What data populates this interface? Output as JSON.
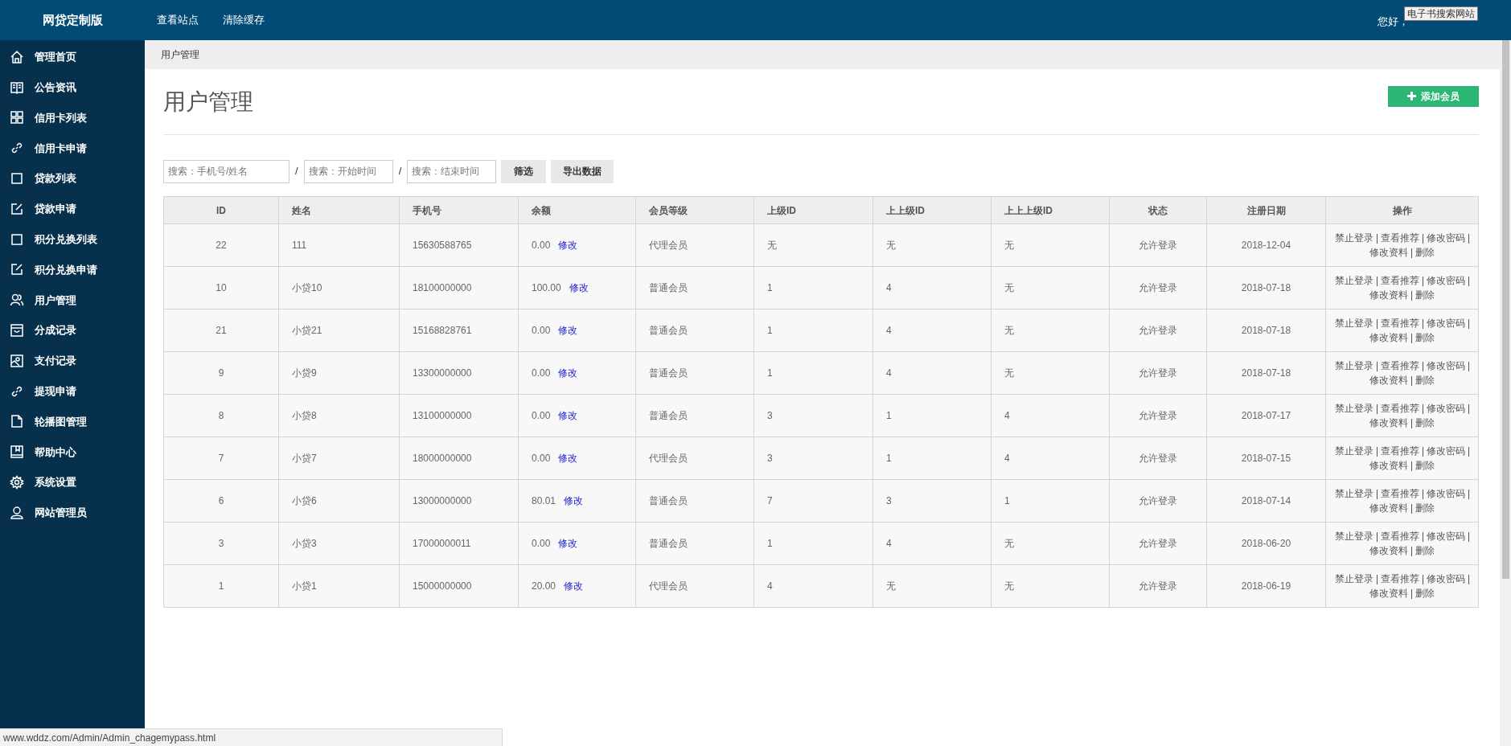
{
  "header": {
    "brand": "网贷定制版",
    "nav": [
      "查看站点",
      "清除缓存"
    ],
    "greeting": "您好，",
    "tooltip": "电子书搜索网站"
  },
  "sidebar": {
    "items": [
      {
        "label": "管理首页",
        "selected": false
      },
      {
        "label": "公告资讯",
        "selected": false
      },
      {
        "label": "信用卡列表",
        "selected": false
      },
      {
        "label": "信用卡申请",
        "selected": false
      },
      {
        "label": "贷款列表",
        "selected": false
      },
      {
        "label": "贷款申请",
        "selected": false
      },
      {
        "label": "积分兑换列表",
        "selected": false
      },
      {
        "label": "积分兑换申请",
        "selected": false
      },
      {
        "label": "用户管理",
        "selected": false
      },
      {
        "label": "分成记录",
        "selected": false
      },
      {
        "label": "支付记录",
        "selected": false
      },
      {
        "label": "提现申请",
        "selected": false
      },
      {
        "label": "轮播图管理",
        "selected": false
      },
      {
        "label": "帮助中心",
        "selected": false
      },
      {
        "label": "系统设置",
        "selected": false
      },
      {
        "label": "网站管理员",
        "selected": false
      }
    ]
  },
  "breadcrumb": "用户管理",
  "page_title": "用户管理",
  "add_button": "添加会员",
  "filters": {
    "fields": [
      {
        "placeholder": "搜索：手机号/姓名"
      },
      {
        "placeholder": "搜索：开始时间"
      },
      {
        "placeholder": "搜索：结束时间"
      }
    ],
    "separators": [
      "/",
      "/"
    ],
    "buttons": [
      "筛选",
      "导出数据"
    ]
  },
  "table": {
    "columns": [
      "ID",
      "姓名",
      "手机号",
      "余额",
      "会员等级",
      "上级ID",
      "上上级ID",
      "上上上级ID",
      "状态",
      "注册日期",
      "操作"
    ],
    "rows": [
      {
        "id": "22",
        "name": "111",
        "phone": "15630588765",
        "balance": "0.00",
        "edit": "修改",
        "level": "代理会员",
        "parent": "无",
        "grandparent": "无",
        "great_grandparent": "无",
        "status": "允许登录",
        "date": "2018-12-04",
        "actions": [
          "禁止登录",
          "查看推荐",
          "修改密码",
          "修改资料",
          "删除"
        ]
      },
      {
        "id": "10",
        "name": "小贷10",
        "phone": "18100000000",
        "balance": "100.00",
        "edit": "修改",
        "level": "普通会员",
        "parent": "1",
        "grandparent": "4",
        "great_grandparent": "无",
        "status": "允许登录",
        "date": "2018-07-18",
        "actions": [
          "禁止登录",
          "查看推荐",
          "修改密码",
          "修改资料",
          "删除"
        ]
      },
      {
        "id": "21",
        "name": "小贷21",
        "phone": "15168828761",
        "balance": "0.00",
        "edit": "修改",
        "level": "普通会员",
        "parent": "1",
        "grandparent": "4",
        "great_grandparent": "无",
        "status": "允许登录",
        "date": "2018-07-18",
        "actions": [
          "禁止登录",
          "查看推荐",
          "修改密码",
          "修改资料",
          "删除"
        ]
      },
      {
        "id": "9",
        "name": "小贷9",
        "phone": "13300000000",
        "balance": "0.00",
        "edit": "修改",
        "level": "普通会员",
        "parent": "1",
        "grandparent": "4",
        "great_grandparent": "无",
        "status": "允许登录",
        "date": "2018-07-18",
        "actions": [
          "禁止登录",
          "查看推荐",
          "修改密码",
          "修改资料",
          "删除"
        ]
      },
      {
        "id": "8",
        "name": "小贷8",
        "phone": "13100000000",
        "balance": "0.00",
        "edit": "修改",
        "level": "普通会员",
        "parent": "3",
        "grandparent": "1",
        "great_grandparent": "4",
        "status": "允许登录",
        "date": "2018-07-17",
        "actions": [
          "禁止登录",
          "查看推荐",
          "修改密码",
          "修改资料",
          "删除"
        ]
      },
      {
        "id": "7",
        "name": "小贷7",
        "phone": "18000000000",
        "balance": "0.00",
        "edit": "修改",
        "level": "代理会员",
        "parent": "3",
        "grandparent": "1",
        "great_grandparent": "4",
        "status": "允许登录",
        "date": "2018-07-15",
        "actions": [
          "禁止登录",
          "查看推荐",
          "修改密码",
          "修改资料",
          "删除"
        ]
      },
      {
        "id": "6",
        "name": "小贷6",
        "phone": "13000000000",
        "balance": "80.01",
        "edit": "修改",
        "level": "普通会员",
        "parent": "7",
        "grandparent": "3",
        "great_grandparent": "1",
        "status": "允许登录",
        "date": "2018-07-14",
        "actions": [
          "禁止登录",
          "查看推荐",
          "修改密码",
          "修改资料",
          "删除"
        ]
      },
      {
        "id": "3",
        "name": "小贷3",
        "phone": "17000000011",
        "balance": "0.00",
        "edit": "修改",
        "level": "普通会员",
        "parent": "1",
        "grandparent": "4",
        "great_grandparent": "无",
        "status": "允许登录",
        "date": "2018-06-20",
        "actions": [
          "禁止登录",
          "查看推荐",
          "修改密码",
          "修改资料",
          "删除"
        ]
      },
      {
        "id": "1",
        "name": "小贷1",
        "phone": "15000000000",
        "balance": "20.00",
        "edit": "修改",
        "level": "代理会员",
        "parent": "4",
        "grandparent": "无",
        "great_grandparent": "无",
        "status": "允许登录",
        "date": "2018-06-19",
        "actions": [
          "禁止登录",
          "查看推荐",
          "修改密码",
          "修改资料",
          "删除"
        ]
      }
    ]
  },
  "status_bar": "www.wddz.com/Admin/Admin_chagemypass.html"
}
